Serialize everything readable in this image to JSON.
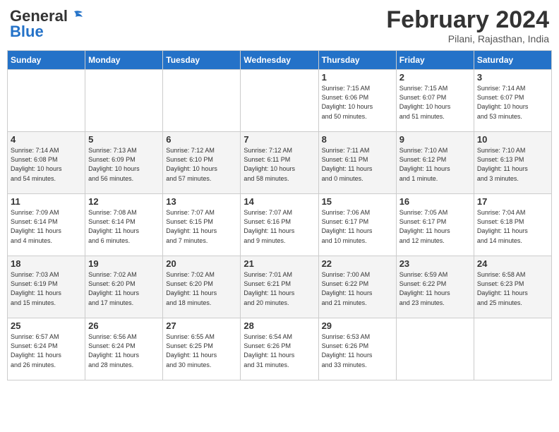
{
  "header": {
    "logo_general": "General",
    "logo_blue": "Blue",
    "month_title": "February 2024",
    "subtitle": "Pilani, Rajasthan, India"
  },
  "days_of_week": [
    "Sunday",
    "Monday",
    "Tuesday",
    "Wednesday",
    "Thursday",
    "Friday",
    "Saturday"
  ],
  "weeks": [
    [
      {
        "day": "",
        "info": ""
      },
      {
        "day": "",
        "info": ""
      },
      {
        "day": "",
        "info": ""
      },
      {
        "day": "",
        "info": ""
      },
      {
        "day": "1",
        "info": "Sunrise: 7:15 AM\nSunset: 6:06 PM\nDaylight: 10 hours\nand 50 minutes."
      },
      {
        "day": "2",
        "info": "Sunrise: 7:15 AM\nSunset: 6:07 PM\nDaylight: 10 hours\nand 51 minutes."
      },
      {
        "day": "3",
        "info": "Sunrise: 7:14 AM\nSunset: 6:07 PM\nDaylight: 10 hours\nand 53 minutes."
      }
    ],
    [
      {
        "day": "4",
        "info": "Sunrise: 7:14 AM\nSunset: 6:08 PM\nDaylight: 10 hours\nand 54 minutes."
      },
      {
        "day": "5",
        "info": "Sunrise: 7:13 AM\nSunset: 6:09 PM\nDaylight: 10 hours\nand 56 minutes."
      },
      {
        "day": "6",
        "info": "Sunrise: 7:12 AM\nSunset: 6:10 PM\nDaylight: 10 hours\nand 57 minutes."
      },
      {
        "day": "7",
        "info": "Sunrise: 7:12 AM\nSunset: 6:11 PM\nDaylight: 10 hours\nand 58 minutes."
      },
      {
        "day": "8",
        "info": "Sunrise: 7:11 AM\nSunset: 6:11 PM\nDaylight: 11 hours\nand 0 minutes."
      },
      {
        "day": "9",
        "info": "Sunrise: 7:10 AM\nSunset: 6:12 PM\nDaylight: 11 hours\nand 1 minute."
      },
      {
        "day": "10",
        "info": "Sunrise: 7:10 AM\nSunset: 6:13 PM\nDaylight: 11 hours\nand 3 minutes."
      }
    ],
    [
      {
        "day": "11",
        "info": "Sunrise: 7:09 AM\nSunset: 6:14 PM\nDaylight: 11 hours\nand 4 minutes."
      },
      {
        "day": "12",
        "info": "Sunrise: 7:08 AM\nSunset: 6:14 PM\nDaylight: 11 hours\nand 6 minutes."
      },
      {
        "day": "13",
        "info": "Sunrise: 7:07 AM\nSunset: 6:15 PM\nDaylight: 11 hours\nand 7 minutes."
      },
      {
        "day": "14",
        "info": "Sunrise: 7:07 AM\nSunset: 6:16 PM\nDaylight: 11 hours\nand 9 minutes."
      },
      {
        "day": "15",
        "info": "Sunrise: 7:06 AM\nSunset: 6:17 PM\nDaylight: 11 hours\nand 10 minutes."
      },
      {
        "day": "16",
        "info": "Sunrise: 7:05 AM\nSunset: 6:17 PM\nDaylight: 11 hours\nand 12 minutes."
      },
      {
        "day": "17",
        "info": "Sunrise: 7:04 AM\nSunset: 6:18 PM\nDaylight: 11 hours\nand 14 minutes."
      }
    ],
    [
      {
        "day": "18",
        "info": "Sunrise: 7:03 AM\nSunset: 6:19 PM\nDaylight: 11 hours\nand 15 minutes."
      },
      {
        "day": "19",
        "info": "Sunrise: 7:02 AM\nSunset: 6:20 PM\nDaylight: 11 hours\nand 17 minutes."
      },
      {
        "day": "20",
        "info": "Sunrise: 7:02 AM\nSunset: 6:20 PM\nDaylight: 11 hours\nand 18 minutes."
      },
      {
        "day": "21",
        "info": "Sunrise: 7:01 AM\nSunset: 6:21 PM\nDaylight: 11 hours\nand 20 minutes."
      },
      {
        "day": "22",
        "info": "Sunrise: 7:00 AM\nSunset: 6:22 PM\nDaylight: 11 hours\nand 21 minutes."
      },
      {
        "day": "23",
        "info": "Sunrise: 6:59 AM\nSunset: 6:22 PM\nDaylight: 11 hours\nand 23 minutes."
      },
      {
        "day": "24",
        "info": "Sunrise: 6:58 AM\nSunset: 6:23 PM\nDaylight: 11 hours\nand 25 minutes."
      }
    ],
    [
      {
        "day": "25",
        "info": "Sunrise: 6:57 AM\nSunset: 6:24 PM\nDaylight: 11 hours\nand 26 minutes."
      },
      {
        "day": "26",
        "info": "Sunrise: 6:56 AM\nSunset: 6:24 PM\nDaylight: 11 hours\nand 28 minutes."
      },
      {
        "day": "27",
        "info": "Sunrise: 6:55 AM\nSunset: 6:25 PM\nDaylight: 11 hours\nand 30 minutes."
      },
      {
        "day": "28",
        "info": "Sunrise: 6:54 AM\nSunset: 6:26 PM\nDaylight: 11 hours\nand 31 minutes."
      },
      {
        "day": "29",
        "info": "Sunrise: 6:53 AM\nSunset: 6:26 PM\nDaylight: 11 hours\nand 33 minutes."
      },
      {
        "day": "",
        "info": ""
      },
      {
        "day": "",
        "info": ""
      }
    ]
  ]
}
